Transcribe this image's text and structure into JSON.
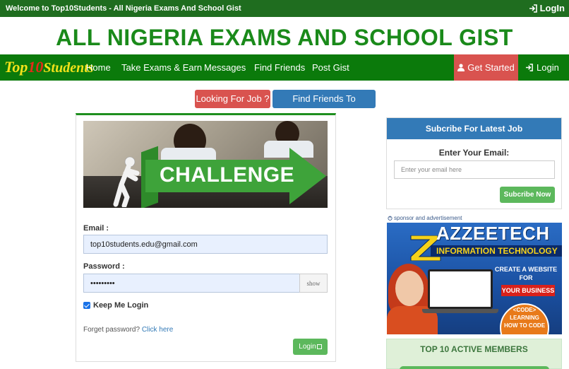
{
  "topbar": {
    "welcome": "Welcome to Top10Students - All Nigeria Exams And School Gist",
    "login": "LogIn"
  },
  "site": {
    "title": "ALL NIGERIA EXAMS AND SCHOOL GIST"
  },
  "logo": {
    "part1": "Top",
    "part2": "10",
    "part3": "Students"
  },
  "nav": {
    "items": [
      {
        "label": "Home"
      },
      {
        "label": "Take Exams & Earn"
      },
      {
        "label": "Messages"
      },
      {
        "label": "Find Friends"
      },
      {
        "label": "Post Gist"
      }
    ],
    "get_started": "Get Started",
    "login": "Login"
  },
  "actions": {
    "looking_for_job": "Looking For Job ?",
    "find_friends": "Find Friends To Challenge"
  },
  "banner": {
    "text": "CHALLENGE"
  },
  "login_form": {
    "email_label": "Email :",
    "email_value": "top10students.edu@gmail.com",
    "password_label": "Password :",
    "password_value": "•••••••••",
    "show_label": "show",
    "keep_label": "Keep Me Login",
    "forget_text": "Forget password?",
    "forget_link": "Click here",
    "login_button": "Login"
  },
  "subscribe": {
    "heading": "Subcribe For Latest Job",
    "label": "Enter Your Email:",
    "placeholder": "Enter your email here",
    "button": "Subcribe Now"
  },
  "sponsor": {
    "label": "sponsor and advertisement"
  },
  "ad": {
    "brand": "AZZEETECH",
    "subtitle": "INFORMATION TECHNOLOGY",
    "create": "CREATE A WEBSITE FOR",
    "business": "YOUR BUSINESS",
    "code_line1": "<CODE>",
    "code_line2": "LEARNING",
    "code_line3": "HOW TO CODE"
  },
  "members": {
    "heading": "TOP 10 ACTIVE MEMBERS"
  },
  "colors": {
    "brand_green": "#0b7a0b",
    "title_green": "#1a8a1a",
    "danger": "#d9534f",
    "primary": "#337ab7",
    "success": "#5cb85c"
  }
}
